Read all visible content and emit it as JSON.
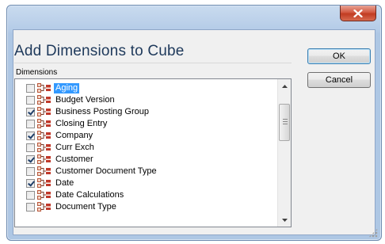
{
  "dialog": {
    "title": "Add Dimensions to Cube",
    "list_label": "Dimensions"
  },
  "buttons": {
    "ok": "OK",
    "cancel": "Cancel"
  },
  "dimensions": [
    {
      "label": "Aging",
      "checked": false,
      "selected": true
    },
    {
      "label": "Budget Version",
      "checked": false,
      "selected": false
    },
    {
      "label": "Business Posting Group",
      "checked": true,
      "selected": false
    },
    {
      "label": "Closing Entry",
      "checked": false,
      "selected": false
    },
    {
      "label": "Company",
      "checked": true,
      "selected": false
    },
    {
      "label": "Curr Exch",
      "checked": false,
      "selected": false
    },
    {
      "label": "Customer",
      "checked": true,
      "selected": false
    },
    {
      "label": "Customer Document Type",
      "checked": false,
      "selected": false
    },
    {
      "label": "Date",
      "checked": true,
      "selected": false
    },
    {
      "label": "Date Calculations",
      "checked": false,
      "selected": false
    },
    {
      "label": "Document Type",
      "checked": false,
      "selected": false
    }
  ],
  "icons": {
    "close": "close-icon",
    "dimension": "dimension-icon",
    "scroll_up": "arrow-up-icon",
    "scroll_down": "arrow-down-icon"
  },
  "colors": {
    "title_text": "#1e395b",
    "selection": "#3399ff",
    "close_button": "#c13b22"
  }
}
